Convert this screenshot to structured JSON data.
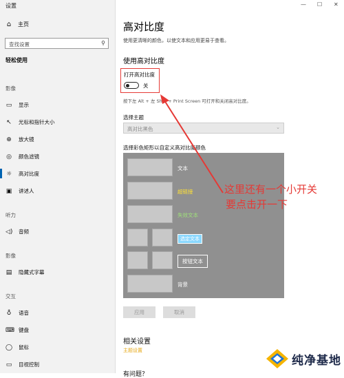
{
  "window": {
    "title": "设置",
    "controls": [
      "—",
      "☐",
      "✕"
    ]
  },
  "sidebar": {
    "home": "主页",
    "search_placeholder": "查找设置",
    "section": "轻松使用",
    "cat_vision": "影像",
    "cat_hearing": "听力",
    "cat_interaction": "交互",
    "items": [
      {
        "label": "显示",
        "icon": "monitor-icon"
      },
      {
        "label": "光标和指针大小",
        "icon": "cursor-icon"
      },
      {
        "label": "放大镜",
        "icon": "magnifier-icon"
      },
      {
        "label": "颜色滤镜",
        "icon": "color-filter-icon"
      },
      {
        "label": "高对比度",
        "icon": "contrast-icon"
      },
      {
        "label": "讲述人",
        "icon": "narrator-icon"
      },
      {
        "label": "音频",
        "icon": "audio-icon"
      },
      {
        "label": "隐藏式字幕",
        "icon": "captions-icon"
      },
      {
        "label": "语音",
        "icon": "microphone-icon"
      },
      {
        "label": "键盘",
        "icon": "keyboard-icon"
      },
      {
        "label": "鼠标",
        "icon": "mouse-icon"
      },
      {
        "label": "目视控制",
        "icon": "eye-control-icon"
      }
    ]
  },
  "main": {
    "title": "高对比度",
    "description": "使用更清晰的颜色，以使文本和应用更易于查看。",
    "section_title": "使用高对比度",
    "toggle_label": "打开高对比度",
    "toggle_state": "关",
    "toggle_on": false,
    "hint": "按下左 Alt + 左 Shift + Print Screen 可打开和关闭高对比度。",
    "theme_label": "选择主题",
    "theme_value": "高对比黑色",
    "swatch_label": "选择彩色矩形以自定义高对比度颜色",
    "preview": {
      "text": "文本",
      "hyperlink": "超链接",
      "disabled": "失效文本",
      "selected": "选定文本",
      "button": "按钮文本",
      "background": "背景"
    },
    "apply": "应用",
    "cancel": "取消",
    "related_title": "相关设置",
    "theme_settings_link": "主题设置",
    "more": "有问题？"
  },
  "annotation": {
    "line1": "这里还有一个小开关",
    "line2": "要点击开一下",
    "color": "#e53935"
  },
  "watermark": {
    "text": "纯净基地"
  }
}
